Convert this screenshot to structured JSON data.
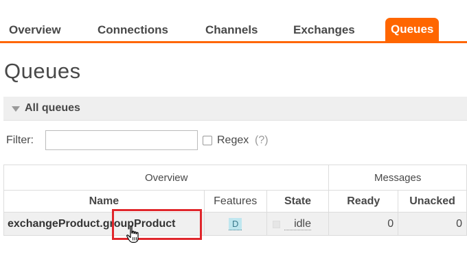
{
  "nav": {
    "tabs": [
      {
        "label": "Overview",
        "active": false
      },
      {
        "label": "Connections",
        "active": false
      },
      {
        "label": "Channels",
        "active": false
      },
      {
        "label": "Exchanges",
        "active": false
      },
      {
        "label": "Queues",
        "active": true
      }
    ]
  },
  "page": {
    "title": "Queues"
  },
  "section": {
    "label": "All queues"
  },
  "filter": {
    "label": "Filter:",
    "value": "",
    "regex_label": "Regex",
    "regex_help": "(?)"
  },
  "table": {
    "groups": [
      "Overview",
      "Messages"
    ],
    "columns": [
      "Name",
      "Features",
      "State",
      "Ready",
      "Unacked"
    ],
    "rows": [
      {
        "name": "exchangeProduct.groupProduct",
        "feature": "D",
        "state": "idle",
        "ready": "0",
        "unacked": "0"
      }
    ]
  },
  "colors": {
    "accent": "#ff6600",
    "highlight": "#e0262b",
    "feature_badge": "#bfe6ef"
  },
  "icons": {
    "section_toggle": "triangle-down-icon",
    "cursor": "hand-pointer-icon"
  }
}
